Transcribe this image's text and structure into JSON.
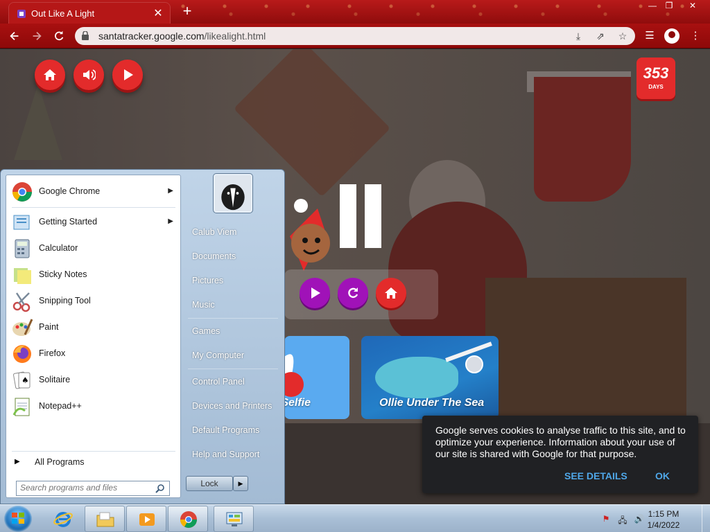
{
  "browser": {
    "tab_title": "Out Like A Light",
    "tab_close": "✕",
    "new_tab": "+",
    "url_host": "santatracker.google.com",
    "url_path": "/likealight.html",
    "window_controls": [
      "—",
      "❐",
      "✕"
    ]
  },
  "page": {
    "days_count": "353",
    "days_label": "DAYS",
    "card_selfie": "Selfie",
    "card_ollie": "Ollie Under The Sea",
    "cookie_text": "Google serves cookies to analyse traffic to this site, and to optimize your experience. Information about your use of our site is shared with Google for that purpose.",
    "cookie_details": "SEE DETAILS",
    "cookie_ok": "OK"
  },
  "start_menu": {
    "programs": [
      {
        "label": "Google Chrome",
        "has_submenu": true,
        "icon": "chrome-icon",
        "color": "#dd4b39"
      },
      {
        "label": "Getting Started",
        "has_submenu": true,
        "icon": "getting-started-icon",
        "color": "#4a90c8"
      },
      {
        "label": "Calculator",
        "has_submenu": false,
        "icon": "calculator-icon",
        "color": "#8fa6be"
      },
      {
        "label": "Sticky Notes",
        "has_submenu": false,
        "icon": "sticky-notes-icon",
        "color": "#e8e26b"
      },
      {
        "label": "Snipping Tool",
        "has_submenu": false,
        "icon": "scissors-icon",
        "color": "#c94b4b"
      },
      {
        "label": "Paint",
        "has_submenu": false,
        "icon": "paint-icon",
        "color": "#6aa5d8"
      },
      {
        "label": "Firefox",
        "has_submenu": false,
        "icon": "firefox-icon",
        "color": "#ff7b1c"
      },
      {
        "label": "Solitaire",
        "has_submenu": false,
        "icon": "solitaire-icon",
        "color": "#e8e8e8"
      },
      {
        "label": "Notepad++",
        "has_submenu": false,
        "icon": "notepad-plus-icon",
        "color": "#7cc24a"
      }
    ],
    "all_programs": "All Programs",
    "search_placeholder": "Search programs and files",
    "right_links": [
      "Calub Viem",
      "Documents",
      "Pictures",
      "Music",
      "Games",
      "My Computer",
      "Control Panel",
      "Devices and Printers",
      "Default Programs",
      "Help and Support"
    ],
    "lock_label": "Lock"
  },
  "taskbar": {
    "time": "1:15 PM",
    "date": "1/4/2022"
  }
}
